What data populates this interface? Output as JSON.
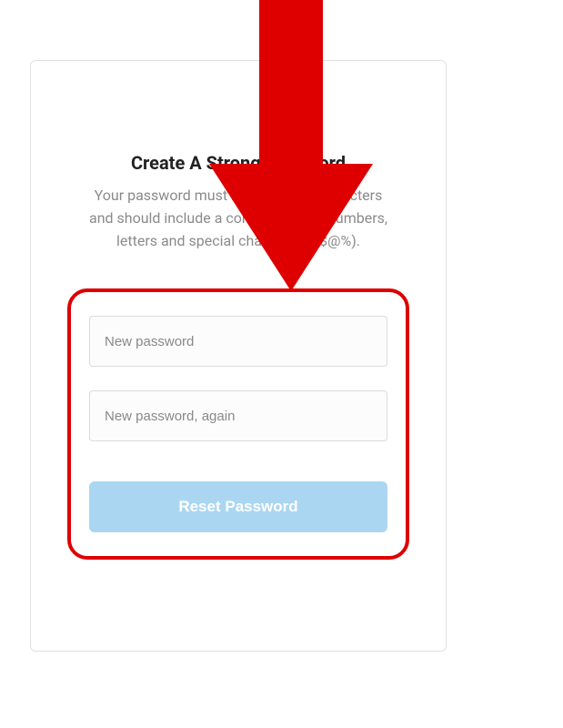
{
  "card": {
    "title": "Create A Strong Password",
    "subtitle": "Your password must be at least 8 characters and should include a combination of numbers, letters and special characters (!$@%).",
    "new_password_placeholder": "New password",
    "confirm_password_placeholder": "New password, again",
    "submit_label": "Reset Password"
  },
  "annotation": {
    "arrow_color": "#de0000",
    "highlight_color": "#de0000"
  }
}
